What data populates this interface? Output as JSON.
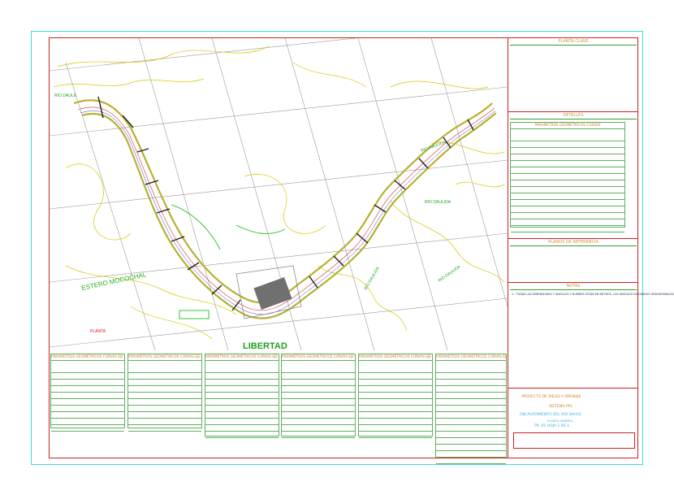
{
  "drawing": {
    "labels": {
      "estero_mocochal": "ESTERO MOCOCHAL",
      "libertad": "LIBERTAD",
      "planta": "PLANTA",
      "rio1": "RIO DAULIDA",
      "rio2": "RIO DAULIDA",
      "rio3": "RIO DAULIDA",
      "rio4": "RIO DAULIDA",
      "rio_left": "RIO DAULE"
    }
  },
  "side": {
    "planta_clave": "PLANTA CLAVE",
    "detalles": "DETALLES",
    "planos_referencia": "PLANOS DE REFERENCIA",
    "notas": "NOTAS",
    "note_text": "1.- TODAS LAS DIMENSIONES Y ANGULOS Y RUMBOS ESTAN EN METROS, LOS ANGULOS EN GRADOS SEXAGESIMALES",
    "detail_table_title": "PARAMETROS GEOMETRICOS CURVAS"
  },
  "tables": [
    {
      "title": "PARAMETROS GEOMETRICOS CURVAS EJE 1"
    },
    {
      "title": "PARAMETROS GEOMETRICOS CURVAS EJE 2"
    },
    {
      "title": "PARAMETROS GEOMETRICOS CURVAS EJE 3"
    },
    {
      "title": "PARAMETROS GEOMETRICOS CURVAS EJE 4"
    },
    {
      "title": "PARAMETROS GEOMETRICOS CURVAS EJE 5"
    },
    {
      "title": "PARAMETROS GEOMETRICOS CURVAS EJE 6"
    }
  ],
  "title_block": {
    "project": "PROYECTO DE RIEGO Y DRENAJE",
    "system": "SISTEMA PPL",
    "work": "ENCAUZAMIENTO DEL RIO DAULE",
    "sub": "PLANTA GENERAL",
    "sheet": "PR. 01 HOJA 1 DE 1"
  },
  "colors": {
    "frame_outer": "#40d8e0",
    "frame_inner": "#d02020",
    "river": "#c8c020",
    "terrain": "#d8c800",
    "grid": "#909090",
    "green": "#20c020"
  }
}
